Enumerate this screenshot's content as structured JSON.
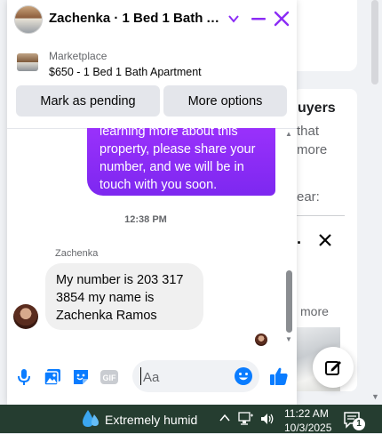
{
  "chat": {
    "title": "Zachenka · 1 Bed 1 Bath Apartment",
    "marketplace": {
      "label": "Marketplace",
      "listing": "$650 - 1 Bed 1 Bath Apartment",
      "mark_pending_label": "Mark as pending",
      "more_options_label": "More options"
    },
    "outgoing_lines": [
      "learning more about this",
      "property, please share your",
      "number, and we will be in",
      "touch with you soon."
    ],
    "timestamp": "12:38 PM",
    "sender_name": "Zachenka",
    "incoming_lines": [
      "My number is 203 317",
      "3854 my name is",
      "Zachenka Ramos"
    ],
    "composer": {
      "placeholder": "Aa"
    },
    "accent_color": "#8b2cf5",
    "icon_color": "#0a7cff"
  },
  "background": {
    "title_fragment": "uyers",
    "line1": "that",
    "line2": "more",
    "line3": "ear:",
    "more_fragment": "more"
  },
  "taskbar": {
    "weather": "Extremely humid",
    "time": "11:22 AM",
    "date": "10/3/2025",
    "notification_count": "1"
  }
}
